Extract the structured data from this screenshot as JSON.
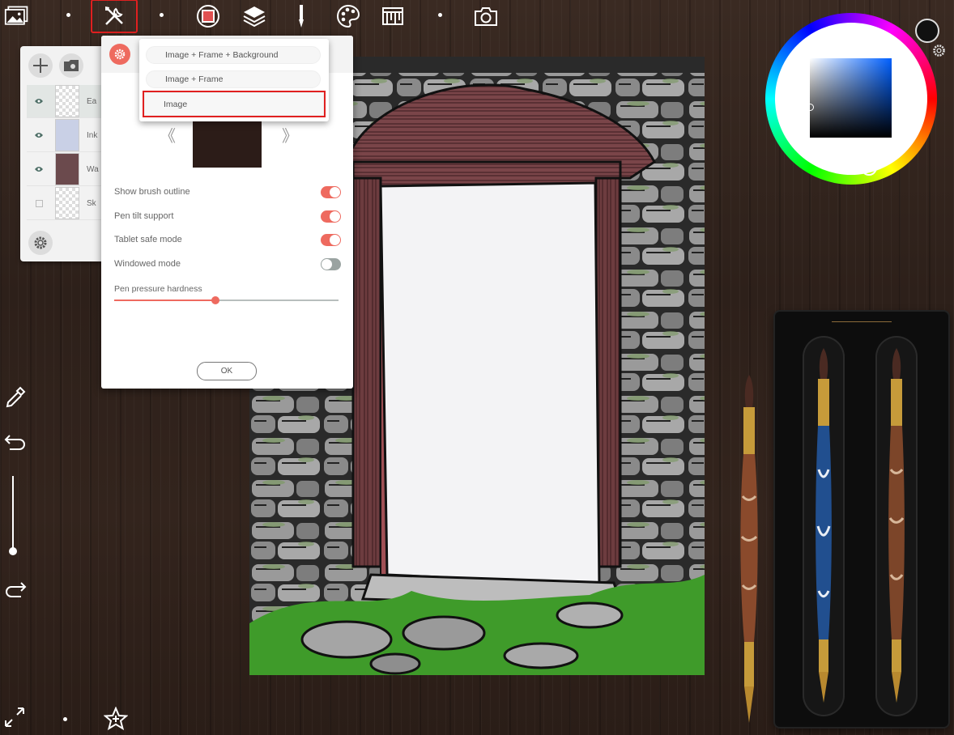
{
  "toolbar": {
    "items": [
      "gallery-icon",
      "tools-icon",
      "frame-icon",
      "layers-icon",
      "brush-icon",
      "palette-icon",
      "ruler-icon",
      "camera-icon"
    ],
    "active": "tools-icon"
  },
  "layers": {
    "rows": [
      {
        "name": "Ea",
        "visible": true,
        "selected": true
      },
      {
        "name": "Ink",
        "visible": true,
        "selected": false
      },
      {
        "name": "Wa",
        "visible": true,
        "selected": false
      },
      {
        "name": "Sk",
        "visible": false,
        "selected": false
      }
    ]
  },
  "export_dropdown": {
    "options": [
      "Image + Frame + Background",
      "Image + Frame",
      "Image"
    ],
    "highlighted": "Image"
  },
  "settings": {
    "prev_glyph": "《",
    "next_glyph": "》",
    "toggles": [
      {
        "label": "Show brush outline",
        "on": true
      },
      {
        "label": "Pen tilt support",
        "on": true
      },
      {
        "label": "Tablet safe mode",
        "on": true
      },
      {
        "label": "Windowed mode",
        "on": false
      }
    ],
    "slider_label": "Pen pressure hardness",
    "slider_value": 0.45,
    "ok_label": "OK"
  },
  "colors": {
    "accent": "#ee6a5f",
    "highlight": "#e02020",
    "current_color": "#0060ff"
  }
}
